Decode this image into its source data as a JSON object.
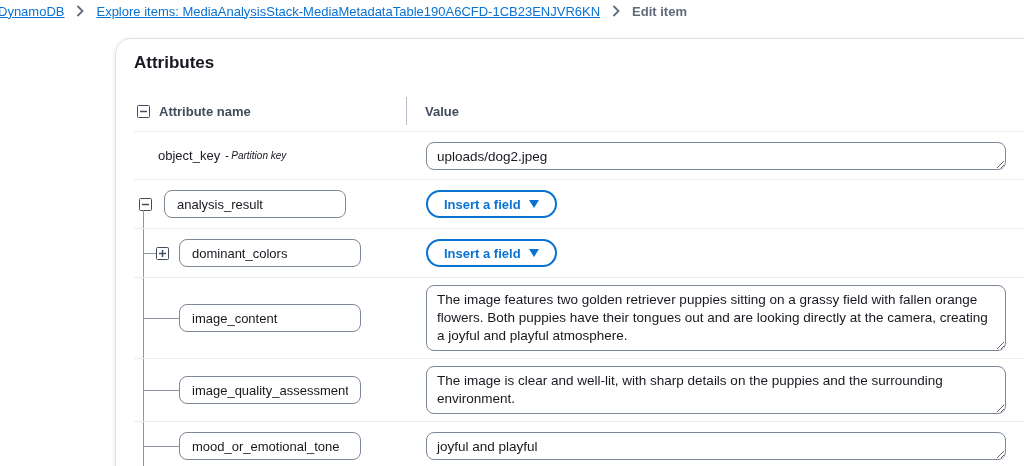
{
  "breadcrumbs": [
    {
      "label": "DynamoDB",
      "link": true
    },
    {
      "label": "Explore items: MediaAnalysisStack-MediaMetadataTable190A6CFD-1CB23ENJVR6KN",
      "link": true
    },
    {
      "label": "Edit item",
      "link": false
    }
  ],
  "panel": {
    "title": "Attributes",
    "columns": {
      "name": "Attribute name",
      "value": "Value"
    },
    "rows": [
      {
        "kind": "key",
        "name": "object_key",
        "key_label": "- Partition key",
        "value": "uploads/dog2.jpeg"
      },
      {
        "kind": "map",
        "name": "analysis_result",
        "expanded": true,
        "action": "Insert a field",
        "children": [
          {
            "kind": "map",
            "name": "dominant_colors",
            "expanded": false,
            "action": "Insert a field"
          },
          {
            "kind": "string",
            "name": "image_content",
            "value": "The image features two golden retriever puppies sitting on a grassy field with fallen orange flowers. Both puppies have their tongues out and are looking directly at the camera, creating a joyful and playful atmosphere."
          },
          {
            "kind": "string",
            "name": "image_quality_assessment",
            "value": "The image is clear and well-lit, with sharp details on the puppies and the surrounding environment."
          },
          {
            "kind": "string",
            "name": "mood_or_emotional_tone",
            "value": "joyful and playful"
          }
        ]
      }
    ]
  }
}
